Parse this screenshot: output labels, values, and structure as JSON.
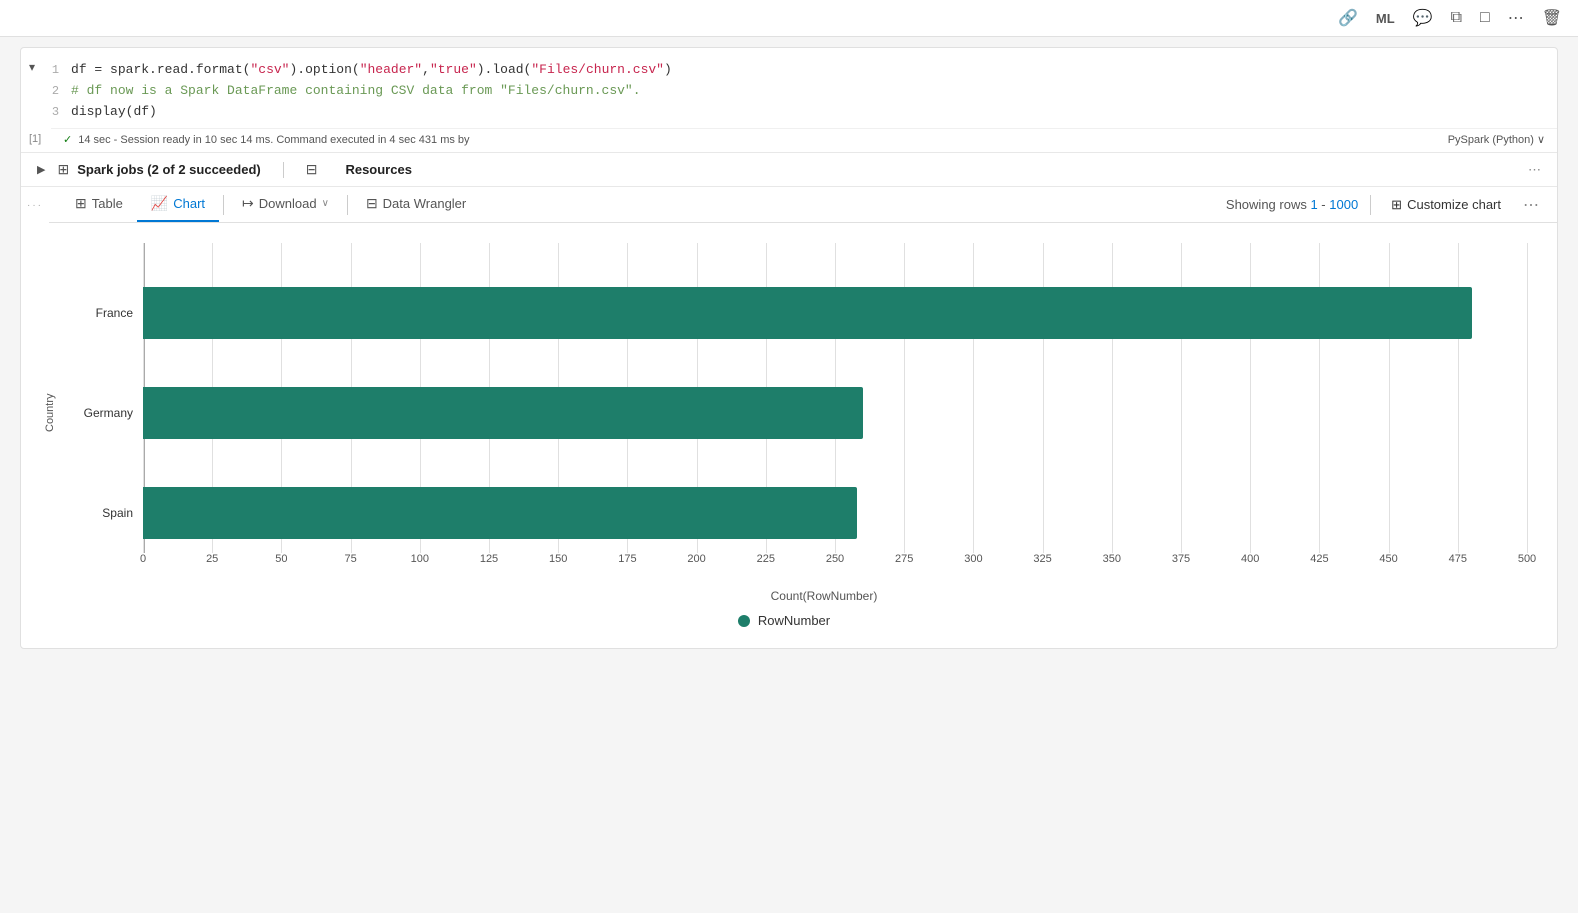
{
  "toolbar": {
    "icons": [
      "share-icon",
      "ml-icon",
      "comment-icon",
      "copy-icon",
      "chat-icon",
      "more-icon",
      "delete-icon"
    ]
  },
  "cell": {
    "number": "[1]",
    "toggle": "▾",
    "lines": [
      {
        "num": "1",
        "segments": [
          {
            "text": "df = spark.read.format(",
            "class": "plain"
          },
          {
            "text": "\"csv\"",
            "class": "str"
          },
          {
            "text": ").option(",
            "class": "plain"
          },
          {
            "text": "\"header\"",
            "class": "str"
          },
          {
            "text": ",",
            "class": "plain"
          },
          {
            "text": "\"true\"",
            "class": "str"
          },
          {
            "text": ").load(",
            "class": "plain"
          },
          {
            "text": "\"Files/churn.csv\"",
            "class": "str"
          },
          {
            "text": ")",
            "class": "plain"
          }
        ]
      },
      {
        "num": "2",
        "segments": [
          {
            "text": "# df now is a Spark DataFrame containing CSV data from ",
            "class": "comment"
          },
          {
            "text": "\"Files/churn.csv\"",
            "class": "comment"
          },
          {
            "text": ".",
            "class": "comment"
          }
        ]
      },
      {
        "num": "3",
        "segments": [
          {
            "text": "display(df)",
            "class": "plain"
          }
        ]
      }
    ],
    "status": {
      "check": "✓",
      "text": "14 sec - Session ready in 10 sec 14 ms. Command executed in 4 sec 431 ms by",
      "right": "PySpark (Python) ∨"
    }
  },
  "spark_jobs": {
    "label": "Spark jobs (2 of 2 succeeded)",
    "resources_label": "Resources"
  },
  "output": {
    "dots": "...",
    "tabs": [
      {
        "id": "table",
        "label": "Table",
        "icon": "⊞",
        "active": false
      },
      {
        "id": "chart",
        "label": "Chart",
        "icon": "📈",
        "active": true
      },
      {
        "id": "download",
        "label": "Download",
        "icon": "↦",
        "active": false
      },
      {
        "id": "data-wrangler",
        "label": "Data Wrangler",
        "icon": "⊟",
        "active": false
      }
    ],
    "rows_info": "Showing rows 1 - 1000",
    "rows_link_start": "1",
    "rows_link_end": "1000",
    "customize_label": "Customize chart",
    "more_dots": "⋯"
  },
  "chart": {
    "y_axis_label": "Country",
    "x_axis_label": "Count(RowNumber)",
    "legend_label": "RowNumber",
    "bars": [
      {
        "label": "France",
        "value": 480,
        "max": 500,
        "top_pct": 10
      },
      {
        "label": "Germany",
        "value": 260,
        "max": 500,
        "top_pct": 40
      },
      {
        "label": "Spain",
        "value": 258,
        "max": 500,
        "top_pct": 70
      }
    ],
    "x_ticks": [
      "0",
      "25",
      "50",
      "75",
      "100",
      "125",
      "150",
      "175",
      "200",
      "225",
      "250",
      "275",
      "300",
      "325",
      "350",
      "375",
      "400",
      "425",
      "450",
      "475",
      "500"
    ],
    "x_max": 500
  }
}
